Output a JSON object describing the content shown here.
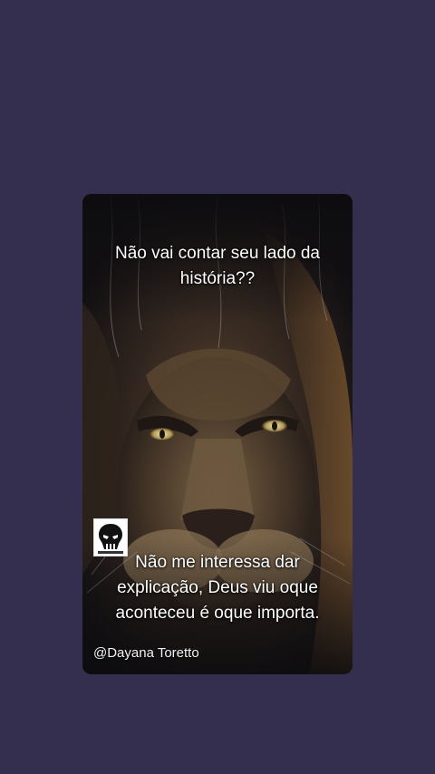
{
  "post": {
    "top_caption": "Não vai contar seu lado da história??",
    "bottom_caption": "Não me interessa dar explicação, Deus viu oque aconteceu é oque importa.",
    "author_handle": "@Dayana Toretto"
  },
  "colors": {
    "page_background": "#342e4f",
    "caption_text": "#ffffff"
  },
  "icons": {
    "badge": "punisher-skull-icon"
  }
}
